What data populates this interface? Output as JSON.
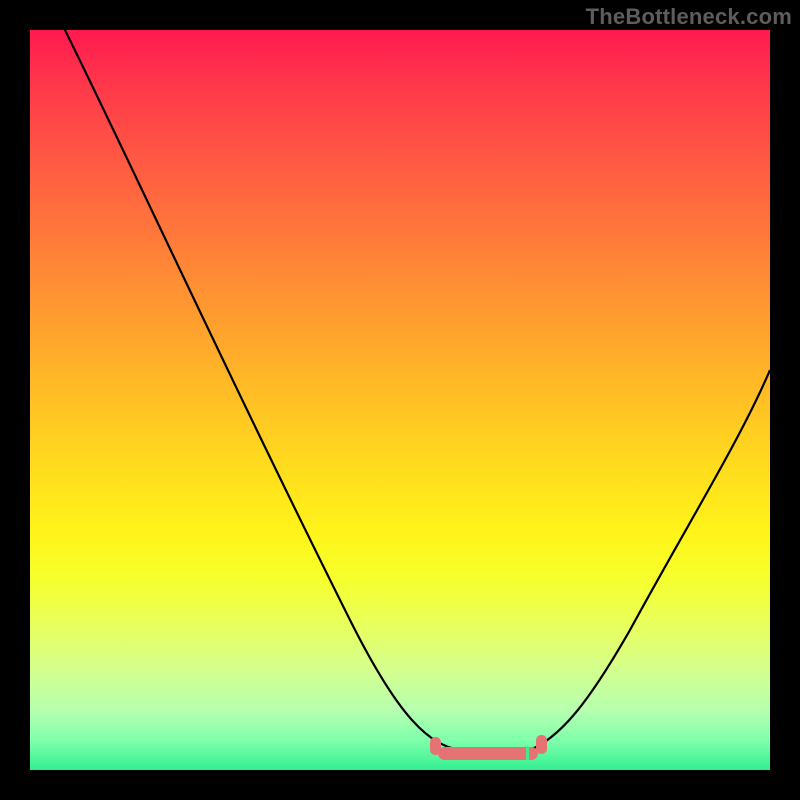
{
  "watermark": "TheBottleneck.com",
  "colors": {
    "background": "#000000",
    "curve_stroke": "#000000",
    "marker_fill": "#e57373",
    "watermark_text": "#5d5d5d"
  },
  "chart_data": {
    "type": "line",
    "title": "",
    "xlabel": "",
    "ylabel": "",
    "xlim": [
      0,
      100
    ],
    "ylim": [
      0,
      100
    ],
    "grid": false,
    "note": "Approximate V-shaped bottleneck curve. Values are estimated from pixel positions; chart has no axis/tick labels.",
    "x": [
      0,
      5,
      10,
      15,
      20,
      25,
      30,
      35,
      40,
      45,
      50,
      55,
      58,
      60,
      62,
      64,
      66,
      68,
      70,
      75,
      80,
      85,
      90,
      95,
      100
    ],
    "y": [
      100,
      92,
      84,
      75,
      67,
      58,
      49,
      40,
      31,
      22,
      13,
      6,
      3,
      2,
      2,
      2,
      2,
      3,
      5,
      10,
      18,
      27,
      36,
      46,
      55
    ],
    "marker_region_x": [
      56,
      70
    ],
    "marker_region_y": [
      2,
      4
    ]
  }
}
